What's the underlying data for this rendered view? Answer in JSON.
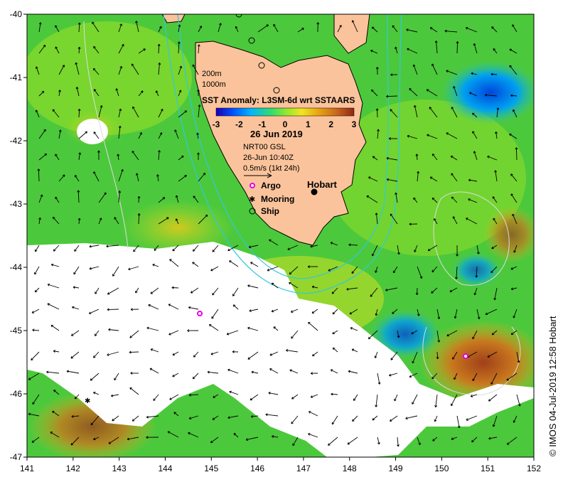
{
  "map": {
    "lon_range": [
      141,
      152
    ],
    "lat_range": [
      -47,
      -40
    ],
    "x_ticks": [
      "141",
      "142",
      "143",
      "144",
      "145",
      "146",
      "147",
      "148",
      "149",
      "150",
      "151",
      "152"
    ],
    "y_ticks": [
      "-40",
      "-41",
      "-42",
      "-43",
      "-44",
      "-45",
      "-46",
      "-47"
    ],
    "isobaths": [
      "200m",
      "1000m"
    ],
    "colorbar_title": "SST Anomaly: L3SM-6d wrt SSTAARS",
    "colorbar_ticks": [
      "-3",
      "-2",
      "-1",
      "0",
      "1",
      "2",
      "3"
    ],
    "colorbar_colors": [
      "#1a00b4",
      "#0050ff",
      "#00b4ff",
      "#32dc6e",
      "#8ce632",
      "#f0e61e",
      "#e6a014",
      "#c8641e",
      "#8c2814"
    ],
    "date": "26 Jun 2019",
    "source": "NRT00 GSL",
    "time": "26-Jun 10:40Z",
    "vector_scale": "0.5m/s (1kt 24h)",
    "city": "Hobart",
    "legend": {
      "argo": "Argo",
      "mooring": "Mooring",
      "ship": "Ship"
    },
    "credit": "© IMOS 04-Jul-2019 12:58 Hobart"
  }
}
